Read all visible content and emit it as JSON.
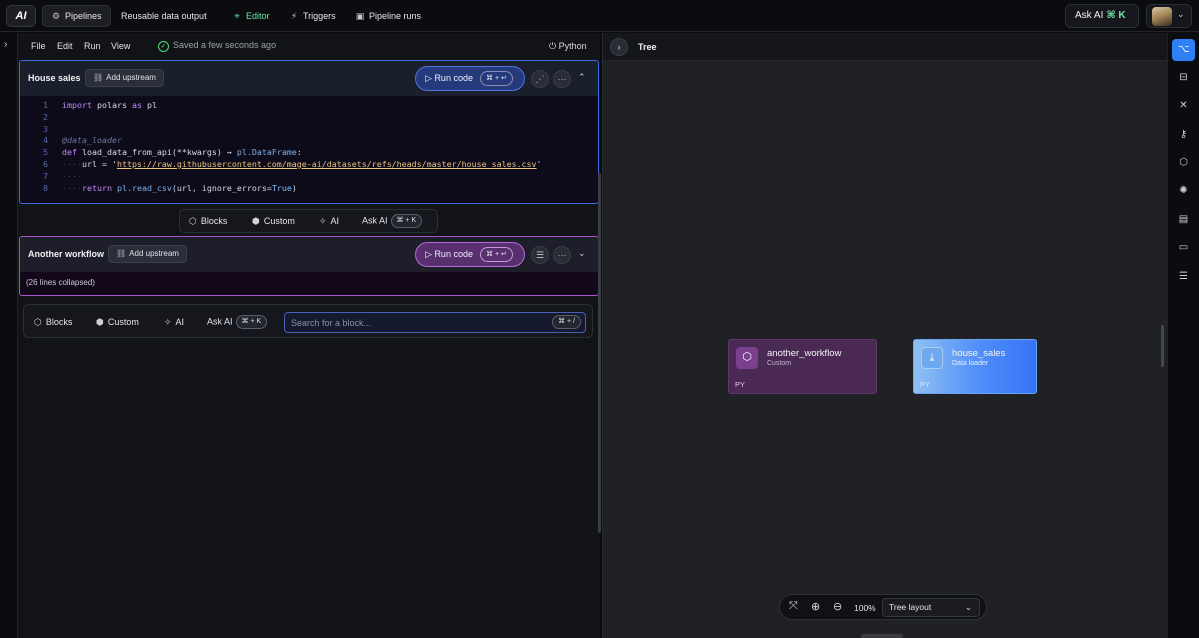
{
  "topbar": {
    "logo": "AI",
    "nav": [
      {
        "label": "Pipelines",
        "icon": "pipelines-icon"
      },
      {
        "label": "Reusable data output"
      },
      {
        "label": "Editor",
        "icon": "editor-icon"
      },
      {
        "label": "Triggers",
        "icon": "triggers-icon"
      },
      {
        "label": "Pipeline runs",
        "icon": "pipeline-runs-icon"
      }
    ],
    "ask_ai": "Ask AI",
    "ask_ai_shortcut": "⌘ K"
  },
  "menubar": {
    "items": [
      "File",
      "Edit",
      "Run",
      "View"
    ],
    "saved_status": "Saved a few seconds ago",
    "language": "Python"
  },
  "blocks": [
    {
      "title": "House sales",
      "add_upstream": "Add upstream",
      "run_label": "Run code",
      "run_shortcut": "⌘ + ↵",
      "accent": "#3d6ae0",
      "code_lines": [
        {
          "n": "1",
          "text": "import polars as pl"
        },
        {
          "n": "2",
          "text": ""
        },
        {
          "n": "3",
          "text": ""
        },
        {
          "n": "4",
          "text": "@data_loader"
        },
        {
          "n": "5",
          "text": "def load_data_from_api(**kwargs) → pl.DataFrame:"
        },
        {
          "n": "6",
          "text": "    url = 'https://raw.githubusercontent.com/mage-ai/datasets/refs/heads/master/house_sales.csv'"
        },
        {
          "n": "7",
          "text": ""
        },
        {
          "n": "8",
          "text": "    return pl.read_csv(url, ignore_errors=True)"
        }
      ]
    },
    {
      "title": "Another workflow",
      "add_upstream": "Add upstream",
      "run_label": "Run code",
      "run_shortcut": "⌘ + ↵",
      "accent": "#a855c7",
      "collapsed_text": "(26 lines collapsed)"
    }
  ],
  "toolbar": {
    "blocks": "Blocks",
    "custom": "Custom",
    "ai": "AI",
    "ask_ai": "Ask AI",
    "ask_ai_shortcut": "⌘ + K",
    "search_placeholder": "Search for a block...",
    "search_shortcut": "⌘ + /"
  },
  "tree": {
    "title": "Tree",
    "nodes": [
      {
        "name": "another_workflow",
        "type": "Custom",
        "lang": "PY",
        "color": "#4a2a55"
      },
      {
        "name": "house_sales",
        "type": "Data loader",
        "lang": "PY",
        "color": "#3574f5"
      }
    ],
    "zoom": "100%",
    "layout": "Tree layout"
  },
  "colors": {
    "accent_blue": "#2f7ff5",
    "accent_green": "#6ee7a8"
  }
}
